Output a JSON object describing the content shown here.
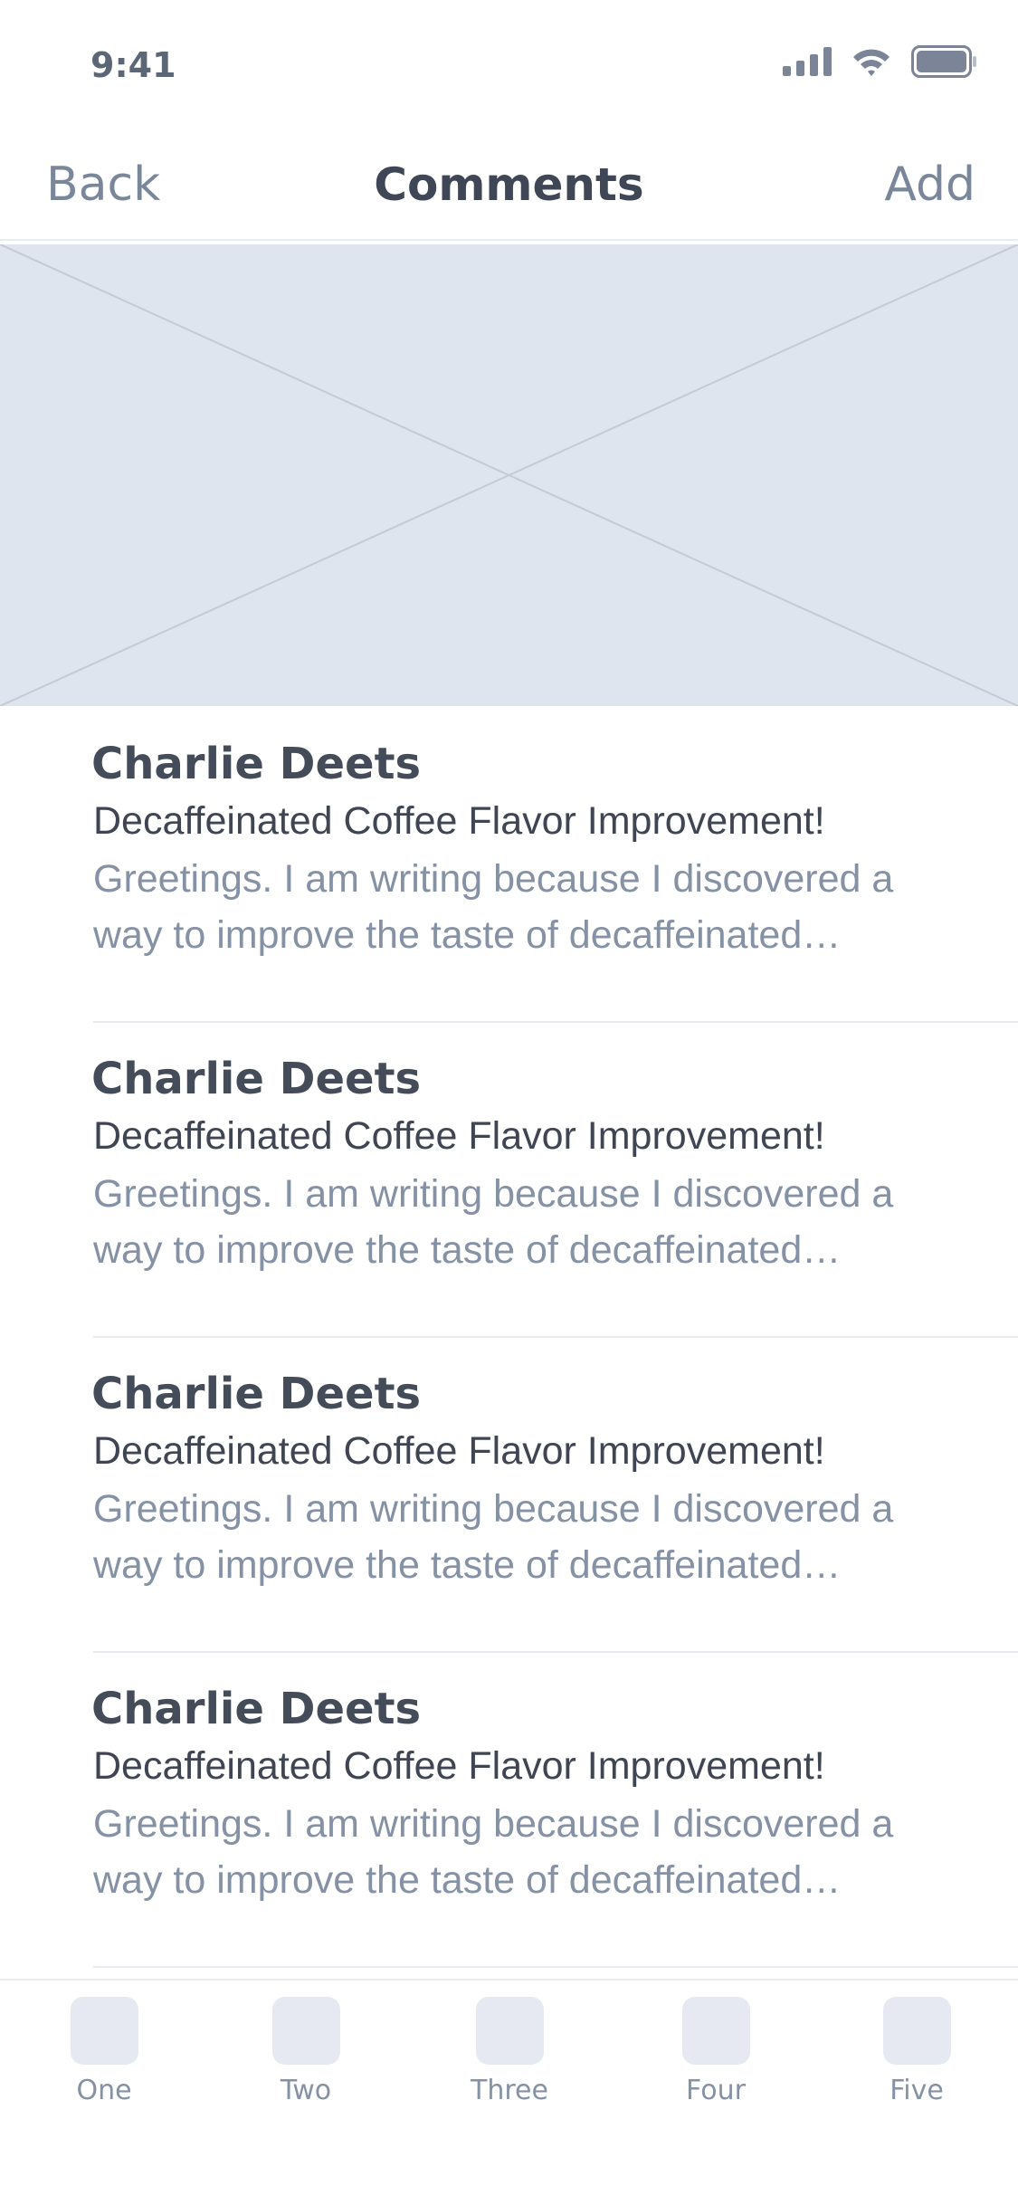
{
  "status_bar": {
    "time": "9:41"
  },
  "nav": {
    "back_label": "Back",
    "title": "Comments",
    "add_label": "Add"
  },
  "comments": [
    {
      "author": "Charlie Deets",
      "subject": "Decaffeinated Coffee Flavor Improvement!",
      "preview": "Greetings. I am writing because I discovered a way to improve the taste of decaffeinated…"
    },
    {
      "author": "Charlie Deets",
      "subject": "Decaffeinated Coffee Flavor Improvement!",
      "preview": "Greetings. I am writing because I discovered a way to improve the taste of decaffeinated…"
    },
    {
      "author": "Charlie Deets",
      "subject": "Decaffeinated Coffee Flavor Improvement!",
      "preview": "Greetings. I am writing because I discovered a way to improve the taste of decaffeinated…"
    },
    {
      "author": "Charlie Deets",
      "subject": "Decaffeinated Coffee Flavor Improvement!",
      "preview": "Greetings. I am writing because I discovered a way to improve the taste of decaffeinated…"
    }
  ],
  "tabs": [
    {
      "label": "One",
      "icon": "tab-placeholder-icon"
    },
    {
      "label": "Two",
      "icon": "tab-placeholder-icon"
    },
    {
      "label": "Three",
      "icon": "tab-placeholder-icon"
    },
    {
      "label": "Four",
      "icon": "tab-placeholder-icon"
    },
    {
      "label": "Five",
      "icon": "tab-placeholder-icon"
    }
  ],
  "colors": {
    "text_primary": "#3f4655",
    "text_secondary": "#8591a4",
    "placeholder_fill": "#dfe5ee",
    "divider": "#e8ebf0"
  }
}
